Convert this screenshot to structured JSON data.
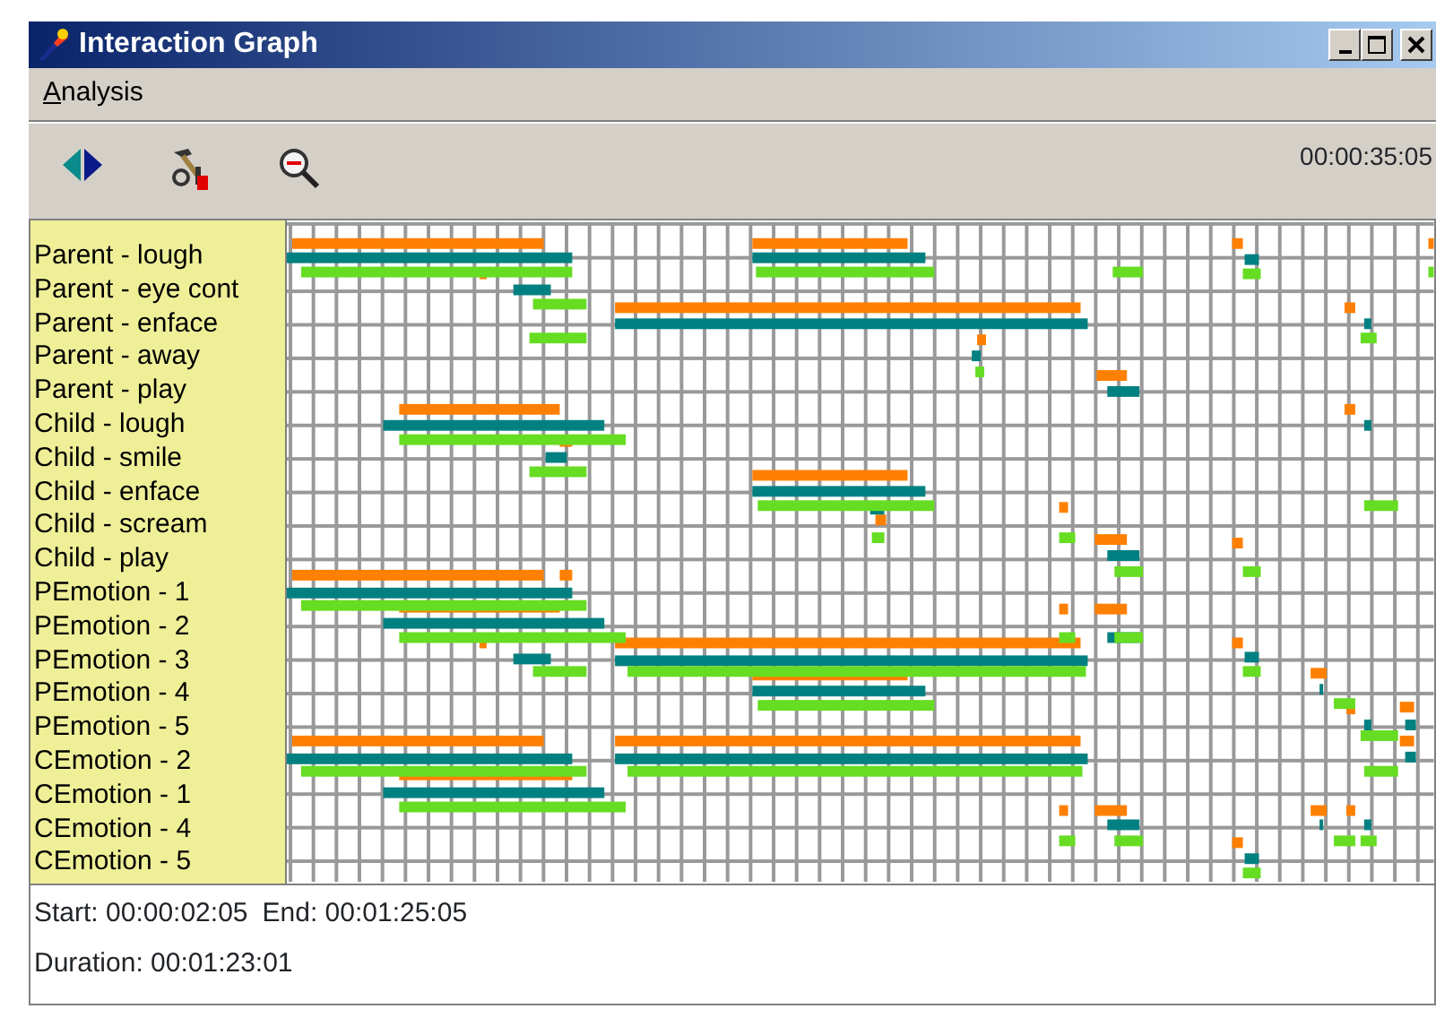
{
  "window": {
    "title": "Interaction Graph"
  },
  "menu": [
    {
      "label": "Analysis"
    }
  ],
  "toolbar": {
    "time": "00:00:35:05"
  },
  "rows": [
    "Parent - lough",
    "Parent - eye cont",
    "Parent - enface",
    "Parent - away",
    "Parent - play",
    "Child - lough",
    "Child - smile",
    "Child - enface",
    "Child - scream",
    "Child - play",
    "PEmotion - 1",
    "PEmotion - 2",
    "PEmotion - 3",
    "PEmotion - 4",
    "PEmotion - 5",
    "CEmotion - 2",
    "CEmotion - 1",
    "CEmotion - 4",
    "CEmotion - 5"
  ],
  "footer": {
    "start": "Start: 00:00:02:05",
    "end": "End: 00:01:25:05",
    "duration": "Duration: 00:01:23:01"
  }
}
